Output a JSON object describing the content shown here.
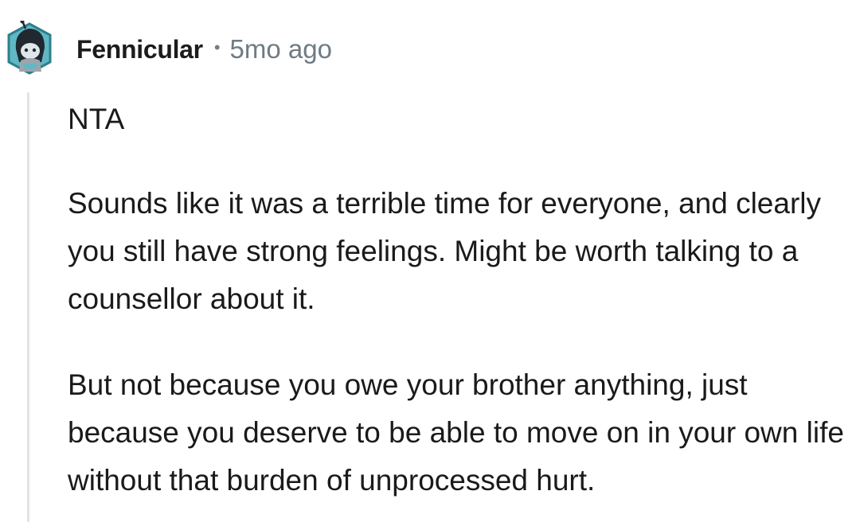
{
  "comment": {
    "author": "Fennicular",
    "separator": "•",
    "timestamp": "5mo ago",
    "avatar_icon": "snoo-avatar-icon",
    "paragraphs": [
      "NTA",
      "Sounds like it was a terrible time for everyone, and clearly you still have strong feelings. Might be worth talking to a counsellor about it.",
      "But not because you owe your brother anything, just because you deserve to be able to move on in your own life without that burden of unprocessed hurt."
    ]
  },
  "colors": {
    "text": "#1a1a1b",
    "meta": "#6e7b83",
    "thread_line": "#e3e3e3",
    "avatar_accent": "#5fb8c4"
  }
}
